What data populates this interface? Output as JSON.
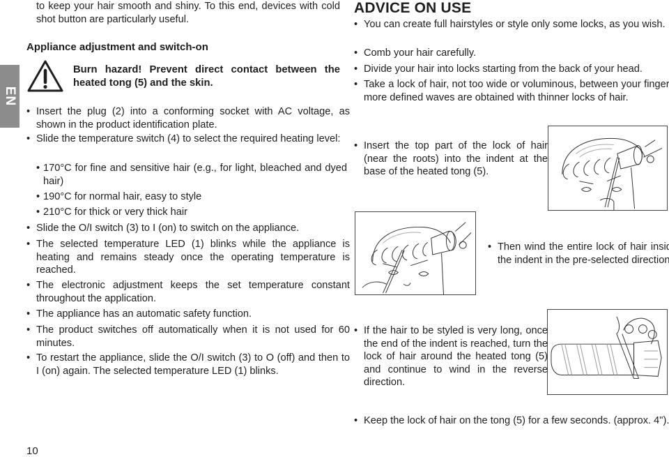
{
  "language_tab": "EN",
  "page_number": "10",
  "left_column": {
    "intro_text": "to keep your hair smooth and shiny. To this end, devices with cold shot button are particularly useful.",
    "section_heading": "Appliance adjustment and switch-on",
    "warning": {
      "icon": "warning-triangle-icon",
      "text": "Burn hazard! Prevent direct contact between the heated tong (5) and the skin."
    },
    "bullets": [
      "Insert the plug (2) into a conforming socket with AC voltage, as shown in the product identification plate.",
      "Slide the temperature switch (4) to select the required heating level:"
    ],
    "temperature_levels": [
      "170°C for fine and sensitive hair (e.g., for light, bleached and dyed hair)",
      "190°C for normal hair, easy to style",
      "210°C for thick or very thick hair"
    ],
    "bullets_after": [
      "Slide the O/I switch (3) to I (on) to switch on the appliance.",
      "The selected temperature LED (1) blinks while the appliance is heating and remains steady once the operating temperature is reached.",
      "The electronic adjustment keeps the set temperature constant throughout the application.",
      "The appliance has an automatic safety function.",
      "The product switches off automatically when it is not used for 60 minutes.",
      "To restart the appliance, slide the O/I switch (3) to O (off) and then to I (on) again. The selected temperature LED (1) blinks."
    ]
  },
  "right_column": {
    "heading": "ADVICE ON USE",
    "bullets": [
      "You can create full hairstyles or style only some locks, as you wish.",
      "Comb your hair carefully.",
      "Divide your hair into locks starting from the back of your head.",
      "Take a lock of hair, not too wide or voluminous, between your fingers; more defined waves are obtained with thinner locks of hair."
    ],
    "steps": [
      {
        "text": "Insert the top part of the lock of hair (near the roots) into the indent at the base of the heated tong (5).",
        "illustration": "insert-lock-illustration"
      },
      {
        "text": "Then wind the entire lock of hair inside the indent in the pre-selected direction.",
        "illustration": "wind-lock-illustration"
      },
      {
        "text": "If the hair to be styled is very long, once the end of the indent is reached, turn the lock of hair around the heated tong (5) and continue to wind in the reverse direction.",
        "illustration": "reverse-wind-illustration"
      }
    ],
    "final_bullet": "Keep the lock of hair on the tong (5) for a few seconds. (approx. 4\")."
  }
}
